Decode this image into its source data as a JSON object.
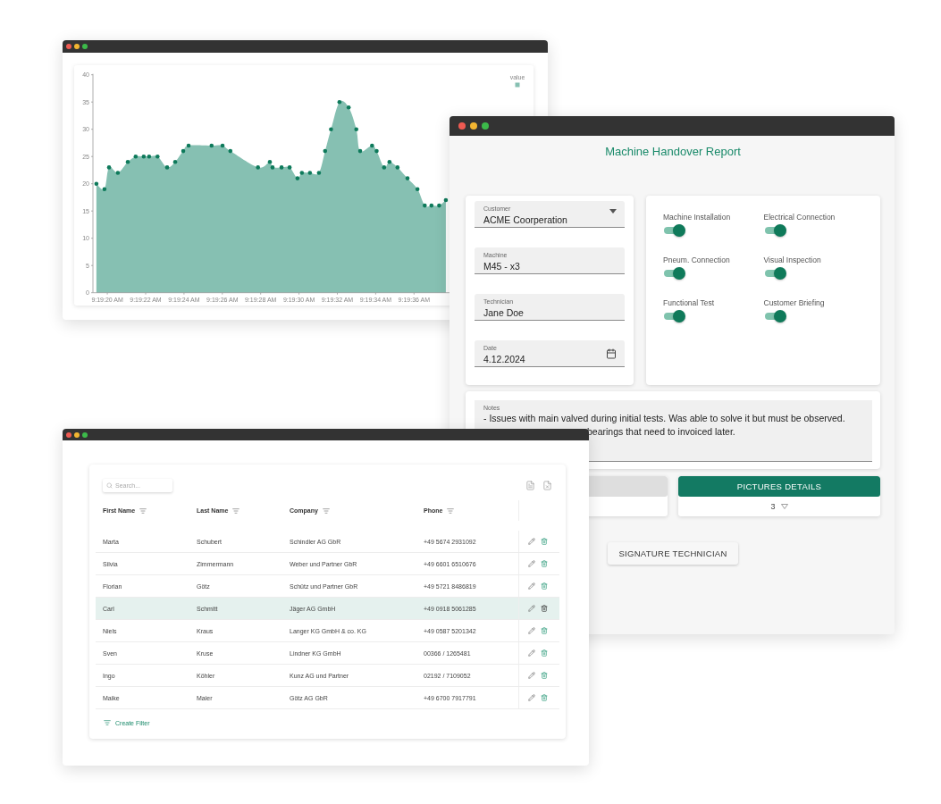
{
  "chart_window": {
    "chart_data": {
      "type": "area",
      "xlim": [
        33559.25,
        33584.89
      ],
      "ylim": [
        0,
        40
      ],
      "yticks": [
        0,
        5,
        10,
        15,
        20,
        25,
        30,
        35,
        40
      ],
      "xticks": [
        {
          "value": 33560,
          "label": "9:19:20 AM"
        },
        {
          "value": 33562,
          "label": "9:19:22 AM"
        },
        {
          "value": 33564,
          "label": "9:19:24 AM"
        },
        {
          "value": 33566,
          "label": "9:19:26 AM"
        },
        {
          "value": 33568,
          "label": "9:19:28 AM"
        },
        {
          "value": 33570,
          "label": "9:19:30 AM"
        },
        {
          "value": 33572,
          "label": "9:19:32 AM"
        },
        {
          "value": 33574,
          "label": "9:19:34 AM"
        },
        {
          "value": 33576,
          "label": "9:19:36 AM"
        }
      ],
      "x": [
        33559.43,
        33559.85,
        33560.09,
        33560.55,
        33561.07,
        33561.48,
        33561.9,
        33562.18,
        33562.62,
        33563.12,
        33563.54,
        33563.96,
        33564.24,
        33565.44,
        33566.01,
        33566.42,
        33567.86,
        33568.48,
        33568.62,
        33569.09,
        33569.51,
        33569.92,
        33570.15,
        33570.57,
        33571.04,
        33571.36,
        33571.67,
        33572.11,
        33572.59,
        33572.99,
        33573.19,
        33573.81,
        33574.05,
        33574.44,
        33574.72,
        33575.14,
        33575.66,
        33576.18,
        33576.56,
        33576.91,
        33577.31,
        33577.66
      ],
      "series": [
        {
          "name": "value",
          "color": "#86c0b2",
          "values": [
            20,
            19,
            23,
            22,
            24,
            25,
            25,
            25,
            25,
            23,
            24,
            26,
            27,
            27,
            27,
            26,
            23,
            24,
            23,
            23,
            23,
            21,
            22,
            22,
            22,
            26,
            30,
            35,
            34,
            30,
            26,
            27,
            26,
            23,
            24,
            23,
            21,
            19,
            16,
            16,
            16,
            17
          ]
        }
      ]
    }
  },
  "form_window": {
    "title": "Machine Handover Report",
    "fields": [
      {
        "label": "Customer",
        "value": "ACME Coorperation",
        "kind": "select"
      },
      {
        "label": "Machine",
        "value": "M45 - x3",
        "kind": "text"
      },
      {
        "label": "Technician",
        "value": "Jane Doe",
        "kind": "text"
      },
      {
        "label": "Date",
        "value": "4.12.2024",
        "kind": "date"
      }
    ],
    "checks": [
      {
        "label": "Machine Installation",
        "on": true
      },
      {
        "label": "Electrical Connection",
        "on": true
      },
      {
        "label": "Pneum. Connection",
        "on": true
      },
      {
        "label": "Visual Inspection",
        "on": true
      },
      {
        "label": "Functional Test",
        "on": true
      },
      {
        "label": "Customer Briefing",
        "on": true
      }
    ],
    "notes": {
      "label": "Notes",
      "lines": [
        "- Issues with main valved during initial tests. Was able to solve it but must be observed.",
        "bearings that need to invoiced later."
      ]
    },
    "actions": [
      {
        "disabled": true
      },
      {
        "label": "PICTURES DETAILS",
        "disabled": false,
        "count": "3"
      }
    ],
    "signature_button": "SIGNATURE TECHNICIAN"
  },
  "table_window": {
    "search": {
      "placeholder": "Search..."
    },
    "columns": [
      "First Name",
      "Last Name",
      "Company",
      "Phone"
    ],
    "rows": [
      {
        "cells": [
          "Marta",
          "Schubert",
          "Schindler AG GbR",
          "+49 5674 2931092"
        ],
        "selected": false
      },
      {
        "cells": [
          "Silvia",
          "Zimmermann",
          "Weber und Partner GbR",
          "+49 6601 6510676"
        ],
        "selected": false
      },
      {
        "cells": [
          "Florian",
          "Götz",
          "Schütz und Partner GbR",
          "+49 5721 8486819"
        ],
        "selected": false
      },
      {
        "cells": [
          "Carl",
          "Schmitt",
          "Jäger AG GmbH",
          "+49 0918 5061285"
        ],
        "selected": true
      },
      {
        "cells": [
          "Niels",
          "Kraus",
          "Langer KG GmbH & co. KG",
          "+49 0587 5201342"
        ],
        "selected": false
      },
      {
        "cells": [
          "Sven",
          "Kruse",
          "Lindner KG GmbH",
          "00366 / 1265481"
        ],
        "selected": false
      },
      {
        "cells": [
          "Ingo",
          "Köhler",
          "Kunz AG und Partner",
          "02192 / 7109052"
        ],
        "selected": false
      },
      {
        "cells": [
          "Maike",
          "Maier",
          "Götz AG GbR",
          "+49 6700 7917791"
        ],
        "selected": false
      }
    ],
    "create_filter": "Create Filter"
  }
}
